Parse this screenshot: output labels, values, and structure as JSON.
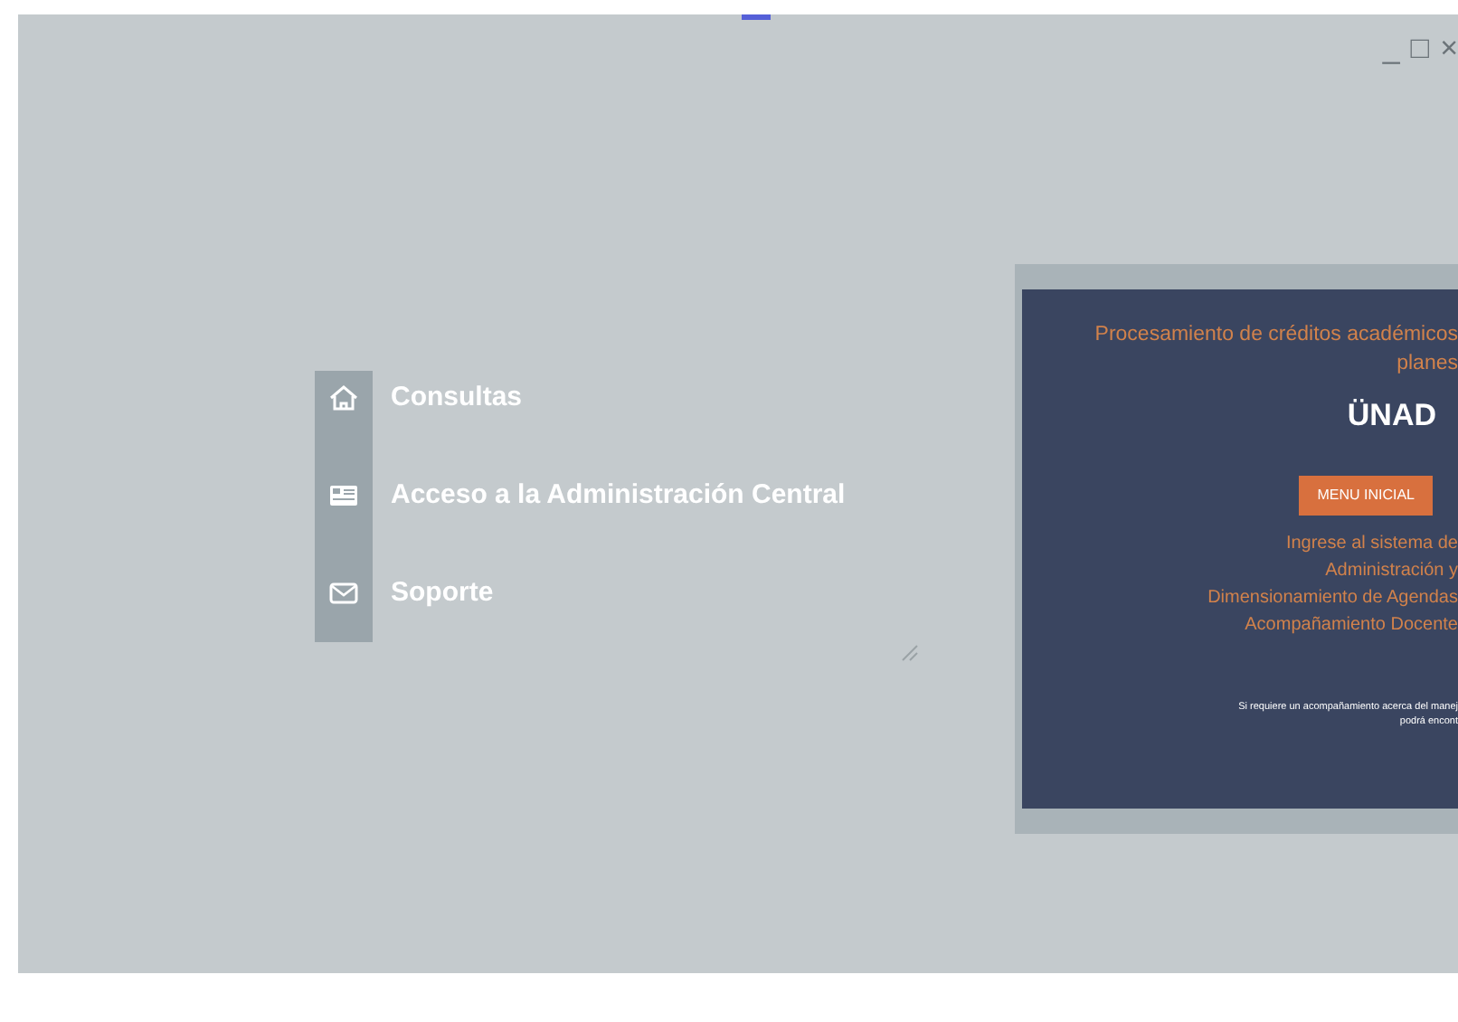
{
  "window": {
    "controls": [
      "_",
      "□",
      "×"
    ]
  },
  "menu": {
    "items": [
      {
        "label": "Consultas"
      },
      {
        "label": "Acceso a la Administración Central"
      },
      {
        "label": "Soporte"
      }
    ]
  },
  "slide": {
    "title_lines": [
      "Procesamiento de créditos académicos",
      "planes"
    ],
    "logo_text": "ÜNAD",
    "button": "MENU INICIAL",
    "lines": [
      "Ingrese al sistema de",
      "Administración y",
      "Dimensionamiento de Agendas",
      "Acompañamiento Docente"
    ],
    "footnote_lines": [
      "Si requiere un acompañamiento acerca del manej",
      "podrá encont"
    ]
  }
}
